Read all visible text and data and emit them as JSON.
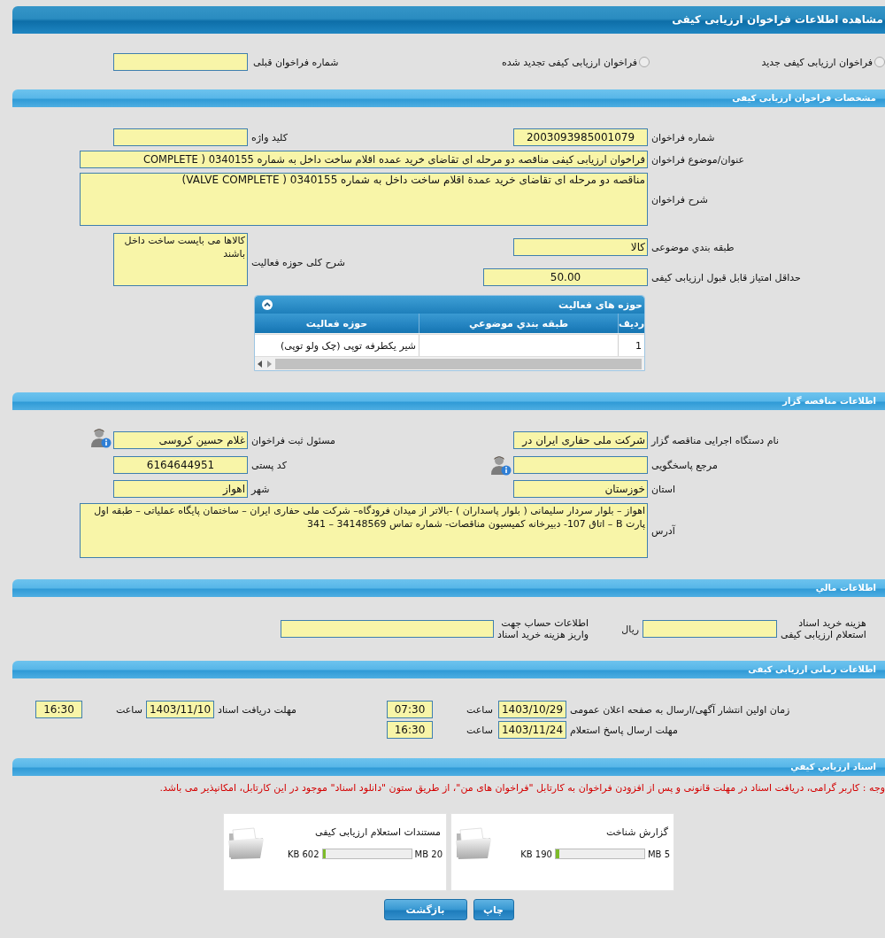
{
  "page_title": "مشاهده اطلاعات فراخوان ارزیابی کیفی",
  "call_types": [
    {
      "label": "فراخوان ارزیابی کیفی جدید",
      "selected": false
    },
    {
      "label": "فراخوان ارزیابی کیفی تجدید شده",
      "selected": false
    }
  ],
  "previous_call_number": {
    "label": "شماره فراخوان قبلی"
  },
  "call_specs": {
    "title": "مشخصات فراخوان ارزیابی کیفی",
    "fields": [
      {
        "label": "شماره فراخوان",
        "value": "2003093985001079"
      },
      {
        "label": "کلید واژه"
      },
      {
        "label": "عنوان/موضوع فراخوان",
        "value": "فراخوان ارزیابی کیفی مناقصه دو مرحله ای تقاضای خرید عمده اقلام ساخت داخل به شماره 0340155 ( COMPLETE"
      },
      {
        "label": "شرح فراخوان",
        "value": "مناقصه دو مرحله ای تقاضای خرید عمدة اقلام ساخت داخل به شماره 0340155 ( VALVE COMPLETE)"
      },
      {
        "label": "طبقه بندي موضوعی",
        "value": "کالا"
      },
      {
        "label": "شرح کلی حوزه فعالیت",
        "value": "کالاها می بایست ساخت داخل باشند"
      },
      {
        "label": "حداقل امتیاز قابل قبول ارزیابی کیفی",
        "value": "50.00"
      }
    ],
    "activity_table": {
      "title": "حوزه های فعالیت",
      "columns": [
        "ردیف",
        "طبقه بندي موضوعي",
        "حوزه فعالیت"
      ],
      "rows": [
        {
          "row_number": "1",
          "activity": "شیر یکطرفه توپی (چک ولو توپی)"
        }
      ]
    }
  },
  "tenderer": {
    "title": "اطلاعات مناقصه گزار",
    "fields": [
      {
        "label": "نام دستگاه اجرایی مناقصه گزار",
        "value": "شرکت ملی حفاری ایران در"
      },
      {
        "label": "مسئول ثبت فراخوان",
        "value": "غلام حسین  کروسی"
      },
      {
        "label": "مرجع پاسخگویی"
      },
      {
        "label": "کد پستی",
        "value": "6164644951"
      },
      {
        "label": "استان",
        "value": "خوزستان"
      },
      {
        "label": "شهر",
        "value": "اهواز"
      },
      {
        "label": "آدرس",
        "value": "اهواز – بلوار سردار سلیمانی ( بلوار پاسداران ) -بالاتر از میدان فرودگاه– شرکت ملی حفاری ایران – ساختمان پایگاه عملیاتی – طبقه اول پارت B – اتاق 107- دبیرخانه کمیسیون مناقصات- شماره تماس 34148569 – 341"
      }
    ]
  },
  "financial": {
    "title": "اطلاعات مالي",
    "fields": [
      {
        "label": "هزینه خرید اسناد\nاستعلام ارزیابی کیفی",
        "unit": "ریال"
      },
      {
        "label": "اطلاعات حساب جهت\nواریز هزینه خرید اسناد"
      }
    ]
  },
  "schedule": {
    "title": "اطلاعات زمانی ارزیابی کیفی",
    "items": [
      {
        "label": "زمان اولین انتشار آگهی/ارسال به صفحه اعلان عمومی",
        "date": "1403/10/29",
        "time_label": "ساعت",
        "time": "07:30"
      },
      {
        "label": "مهلت دریافت اسناد",
        "date": "1403/11/10",
        "time_label": "ساعت",
        "time": "16:30"
      },
      {
        "label": "مهلت ارسال پاسخ استعلام",
        "date": "1403/11/24",
        "time_label": "ساعت",
        "time": "16:30"
      }
    ]
  },
  "documents": {
    "title": "اسناد ارزيابي کيفي",
    "note": "وجه : کاربر گرامی، دریافت اسناد در مهلت قانونی و پس از افزودن فراخوان به کارتابل \"فراخوان های من\"، از طریق ستون \"دانلود اسناد\" موجود در این کارتابل، امکانپذیر می باشد.",
    "files": [
      {
        "name": "گزارش شناخت",
        "size": "190 KB",
        "max": "5 MB",
        "level": 0.04
      },
      {
        "name": "مستندات استعلام ارزیابی کیفی",
        "size": "602 KB",
        "max": "20 MB",
        "level": 0.03
      }
    ]
  },
  "buttons": [
    "چاپ",
    "بازگشت"
  ]
}
